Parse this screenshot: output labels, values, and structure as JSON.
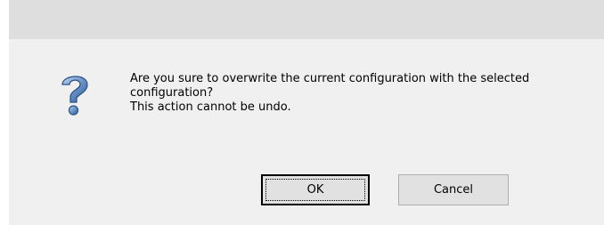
{
  "dialog": {
    "icon": "question-icon",
    "message_lines": [
      "Are you sure to overwrite the current configuration with the selected",
      "configuration?",
      "This action cannot be undo."
    ],
    "buttons": {
      "ok": "OK",
      "cancel": "Cancel"
    }
  },
  "colors": {
    "titlebar": "#dedede",
    "background": "#f0f0f0",
    "icon": "#3f6fa8"
  }
}
